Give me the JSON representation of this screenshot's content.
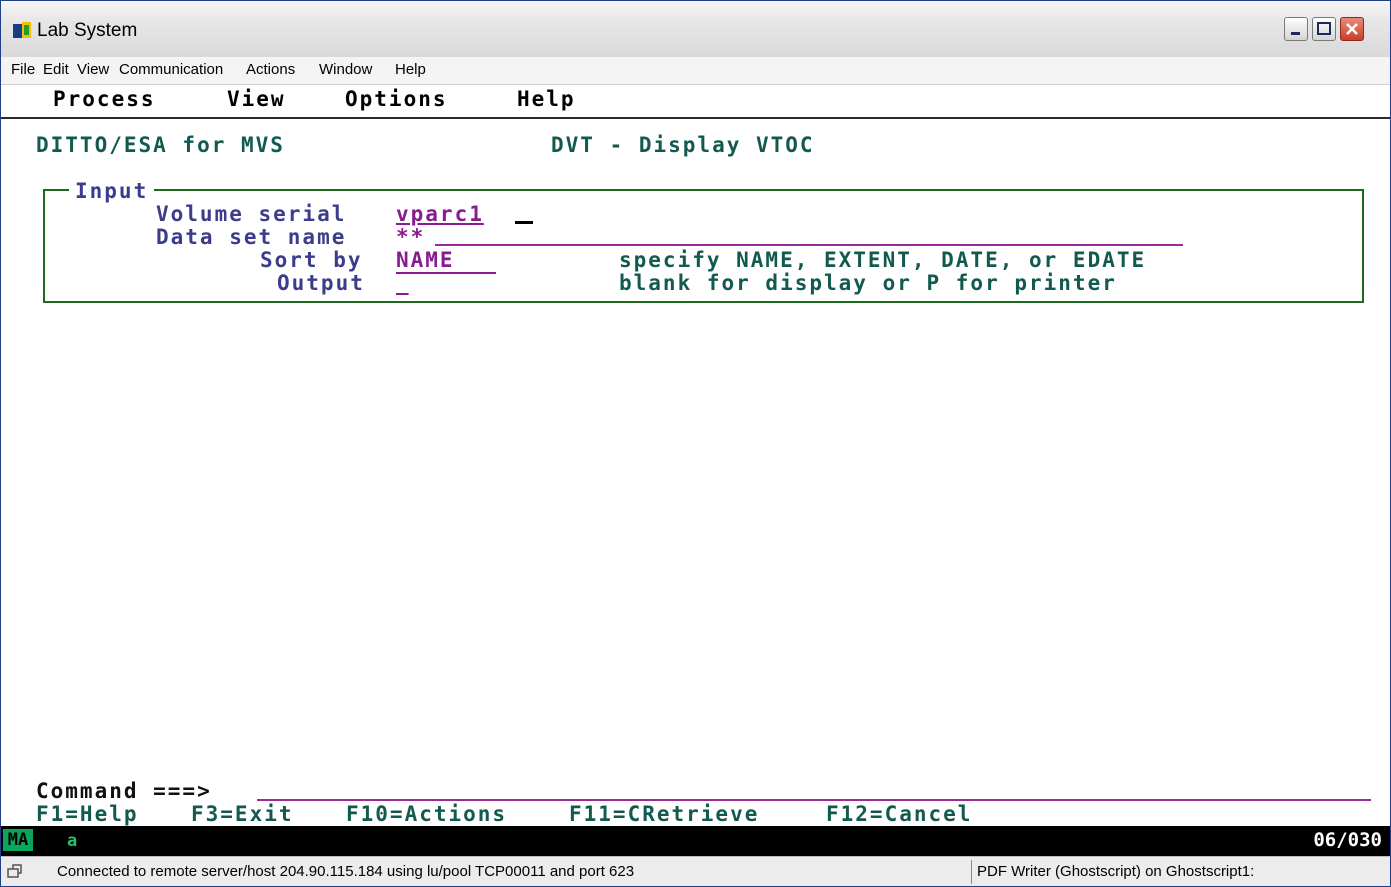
{
  "window": {
    "title": "Lab System"
  },
  "menubar": [
    "File",
    "Edit",
    "View",
    "Communication",
    "Actions",
    "Window",
    "Help"
  ],
  "panel_menu": [
    "Process",
    "View",
    "Options",
    "Help"
  ],
  "header": {
    "product": "DITTO/ESA for MVS",
    "function": "DVT - Display VTOC"
  },
  "input_box": {
    "title": "Input",
    "volume_serial": {
      "label": "Volume serial",
      "value": "vparc1"
    },
    "dataset_name": {
      "label": "Data set name",
      "value": "**"
    },
    "sort_by": {
      "label": "Sort by",
      "value": "NAME",
      "hint": "specify NAME, EXTENT, DATE, or EDATE"
    },
    "output": {
      "label": "Output",
      "value": "_",
      "hint": "blank for display or P for printer"
    }
  },
  "command": {
    "label": "Command ===>",
    "value": ""
  },
  "function_keys": [
    "F1=Help",
    "F3=Exit",
    "F10=Actions",
    "F11=CRetrieve",
    "F12=Cancel"
  ],
  "oia": {
    "ma": "MA",
    "indicator": "a",
    "cursor_pos": "06/030"
  },
  "statusbar": {
    "connection": "Connected to remote server/host 204.90.115.184 using lu/pool TCP00011 and port 623",
    "printer": "PDF Writer (Ghostscript) on Ghostscript1:"
  },
  "colors": {
    "field": "#8a1a92",
    "label": "#3c3c8c",
    "text": "#125a50",
    "box": "#1c6a1c"
  }
}
